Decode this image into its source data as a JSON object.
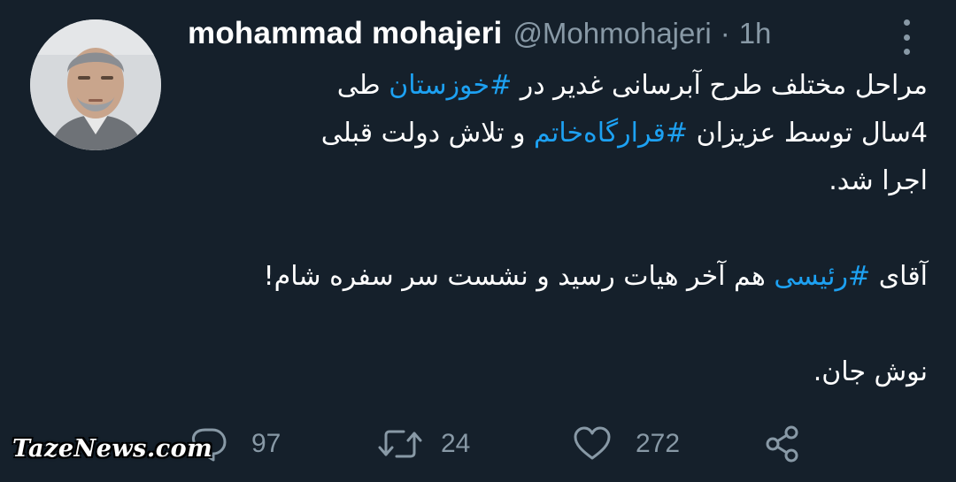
{
  "author": {
    "display_name": "mohammad mohajeri",
    "handle": "@Mohmohajeri",
    "separator": "·",
    "time": "1h"
  },
  "tweet": {
    "line1_pre": "مراحل مختلف طرح آبرسانی غدیر در ",
    "hashtag1": "#خوزستان",
    "line1_post": " طی",
    "line2_pre": "4سال توسط عزیزان ",
    "hashtag2": "#قرارگاه‌خاتم",
    "line2_post": " و تلاش دولت قبلی",
    "line3": "اجرا شد.",
    "line4_pre": "آقای ",
    "hashtag3": "#رئیسی",
    "line4_post": " هم آخر هیات رسید و نشست سر سفره شام!",
    "line5": "نوش جان."
  },
  "actions": {
    "replies": "97",
    "retweets": "24",
    "likes": "272"
  },
  "icons": {
    "reply": "reply-icon",
    "retweet": "retweet-icon",
    "like": "heart-icon",
    "share": "share-icon",
    "more": "more-vertical-icon"
  },
  "watermark": "TazeNews.com",
  "colors": {
    "background": "#15202b",
    "text": "#ffffff",
    "secondary": "#8899a6",
    "link": "#1da1f2"
  }
}
